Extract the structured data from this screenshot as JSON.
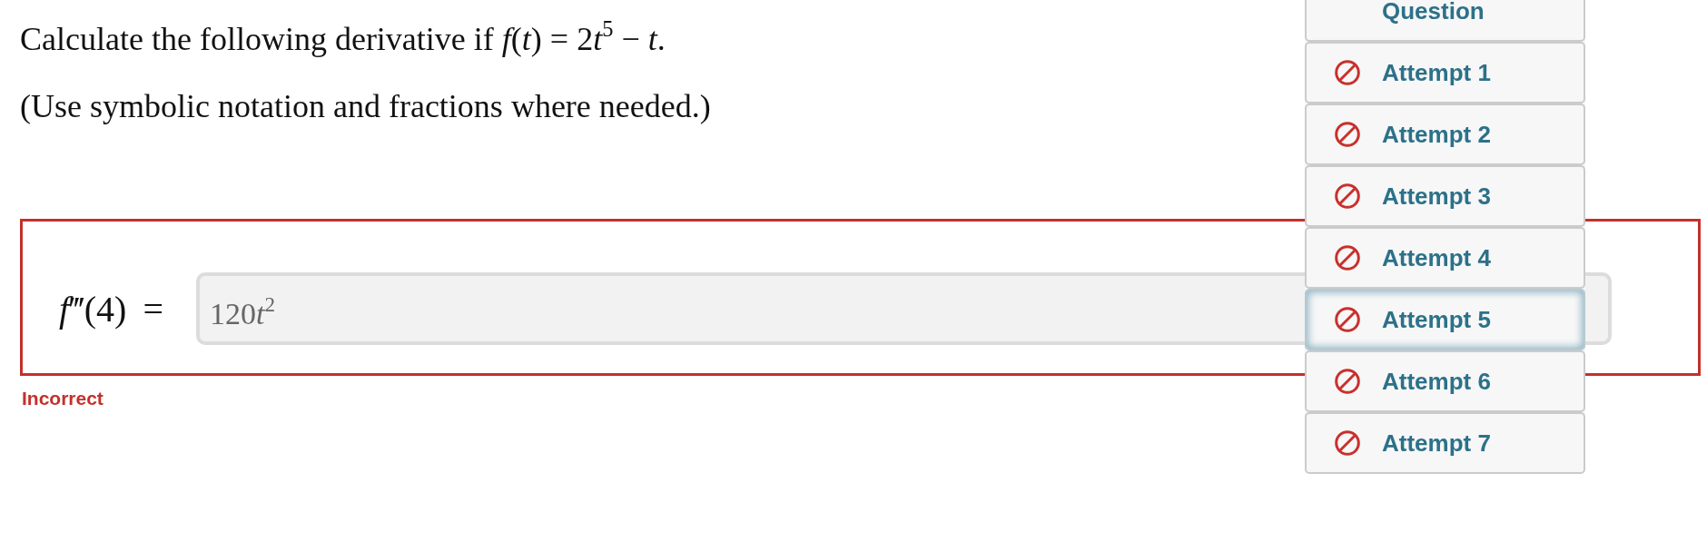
{
  "question": {
    "prompt": [
      {
        "kind": "plain",
        "text": "Calculate the following derivative if "
      },
      {
        "kind": "italic",
        "text": "f"
      },
      {
        "kind": "plain",
        "text": "("
      },
      {
        "kind": "italic",
        "text": "t"
      },
      {
        "kind": "plain",
        "text": ") = 2"
      },
      {
        "kind": "italic",
        "text": "t"
      },
      {
        "kind": "raised",
        "text": "5"
      },
      {
        "kind": "plain",
        "text": " − "
      },
      {
        "kind": "italic",
        "text": "t"
      },
      {
        "kind": "plain",
        "text": "."
      }
    ],
    "instruction": "(Use symbolic notation and fractions where needed.)"
  },
  "answer": {
    "label": [
      {
        "kind": "italic",
        "text": "f"
      },
      {
        "kind": "plain",
        "text": "‴(4) ="
      }
    ],
    "value": [
      {
        "kind": "plain",
        "text": "120"
      },
      {
        "kind": "italic",
        "text": "t"
      },
      {
        "kind": "raised",
        "text": "2"
      }
    ],
    "correct": false,
    "feedback": "Incorrect"
  },
  "attempts_menu": {
    "items": [
      {
        "kind": "header",
        "label": "Question",
        "selected": false
      },
      {
        "kind": "attempt",
        "label": "Attempt 1",
        "correct": false,
        "selected": false
      },
      {
        "kind": "attempt",
        "label": "Attempt 2",
        "correct": false,
        "selected": false
      },
      {
        "kind": "attempt",
        "label": "Attempt 3",
        "correct": false,
        "selected": false
      },
      {
        "kind": "attempt",
        "label": "Attempt 4",
        "correct": false,
        "selected": false
      },
      {
        "kind": "attempt",
        "label": "Attempt 5",
        "correct": false,
        "selected": true
      },
      {
        "kind": "attempt",
        "label": "Attempt 6",
        "correct": false,
        "selected": false
      },
      {
        "kind": "attempt",
        "label": "Attempt 7",
        "correct": false,
        "selected": false
      }
    ]
  }
}
